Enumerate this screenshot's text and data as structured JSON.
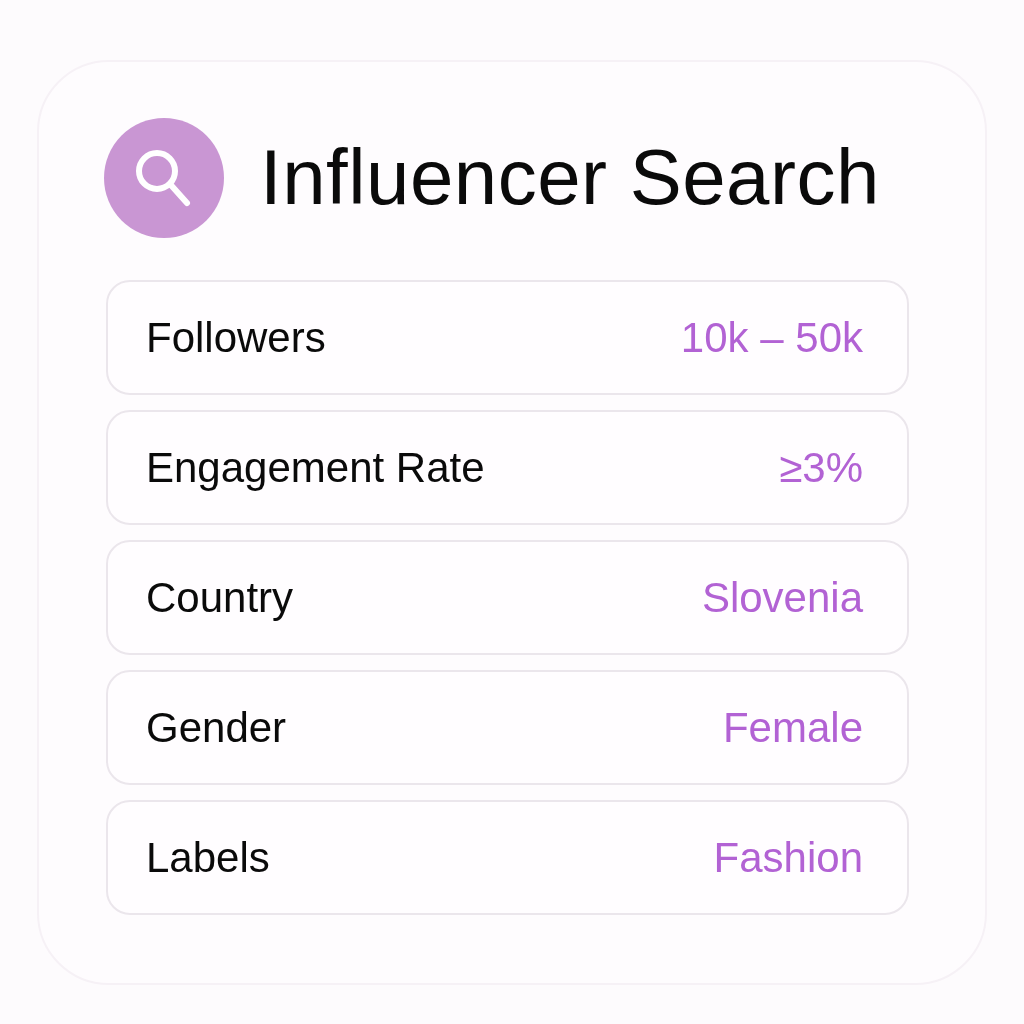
{
  "header": {
    "title": "Influencer Search"
  },
  "filters": [
    {
      "label": "Followers",
      "value": "10k – 50k"
    },
    {
      "label": "Engagement Rate",
      "value": "≥3%"
    },
    {
      "label": "Country",
      "value": "Slovenia"
    },
    {
      "label": "Gender",
      "value": "Female"
    },
    {
      "label": "Labels",
      "value": "Fashion"
    }
  ]
}
